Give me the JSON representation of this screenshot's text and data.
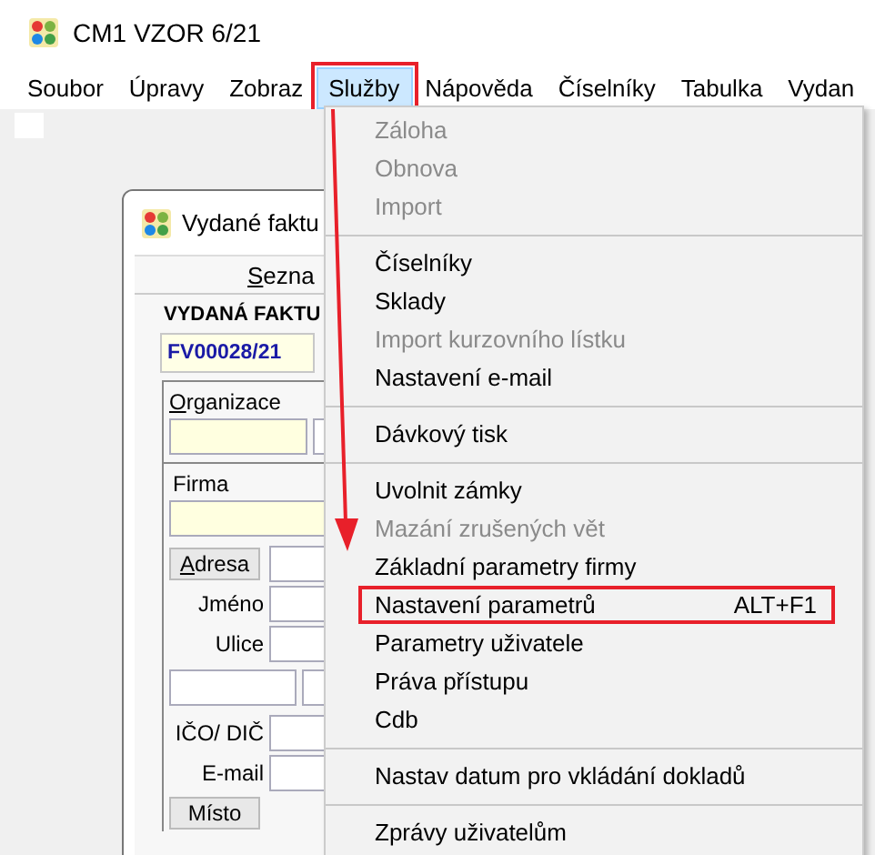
{
  "app": {
    "title": "CM1 VZOR 6/21"
  },
  "menu_bar": [
    {
      "label": "Soubor",
      "selected": false,
      "outlined": false
    },
    {
      "label": "Úpravy",
      "selected": false,
      "outlined": false
    },
    {
      "label": "Zobraz",
      "selected": false,
      "outlined": false
    },
    {
      "label": "Služby",
      "selected": true,
      "outlined": true
    },
    {
      "label": "Nápověda",
      "selected": false,
      "outlined": false
    },
    {
      "label": "Číselníky",
      "selected": false,
      "outlined": false
    },
    {
      "label": "Tabulka",
      "selected": false,
      "outlined": false
    },
    {
      "label": "Vydan",
      "selected": false,
      "outlined": false
    }
  ],
  "dropdown": {
    "groups": [
      [
        {
          "label": "Záloha",
          "disabled": true,
          "outlined": false
        },
        {
          "label": "Obnova",
          "disabled": true,
          "outlined": false
        },
        {
          "label": "Import",
          "disabled": true,
          "outlined": false
        }
      ],
      [
        {
          "label": "Číselníky",
          "disabled": false,
          "outlined": false
        },
        {
          "label": "Sklady",
          "disabled": false,
          "outlined": false
        },
        {
          "label": "Import kurzovního lístku",
          "disabled": true,
          "outlined": false
        },
        {
          "label": "Nastavení e-mail",
          "disabled": false,
          "outlined": false
        }
      ],
      [
        {
          "label": "Dávkový tisk",
          "disabled": false,
          "outlined": false
        }
      ],
      [
        {
          "label": "Uvolnit zámky",
          "disabled": false,
          "outlined": false
        },
        {
          "label": "Mazání zrušených vět",
          "disabled": true,
          "outlined": false
        },
        {
          "label": "Základní parametry firmy",
          "disabled": false,
          "outlined": false
        },
        {
          "label": "Nastavení parametrů",
          "shortcut": "ALT+F1",
          "disabled": false,
          "outlined": true
        },
        {
          "label": "Parametry uživatele",
          "disabled": false,
          "outlined": false
        },
        {
          "label": "Práva přístupu",
          "disabled": false,
          "outlined": false
        },
        {
          "label": "Cdb",
          "disabled": false,
          "outlined": false
        }
      ],
      [
        {
          "label": "Nastav datum pro vkládání dokladů",
          "disabled": false,
          "outlined": false
        }
      ],
      [
        {
          "label": "Zprávy uživatelům",
          "disabled": false,
          "outlined": false
        }
      ]
    ]
  },
  "invoice_window": {
    "title": "Vydané faktu",
    "tab": "Sezna",
    "heading": "VYDANÁ FAKTU",
    "doc_number": "FV00028/21",
    "organization_label": "Organizace",
    "company_label": "Firma",
    "address_button": "Adresa",
    "address_rows": [
      {
        "label": "Jméno"
      },
      {
        "label": "Ulice"
      }
    ],
    "contact_rows": [
      {
        "label": "IČO/ DIČ"
      },
      {
        "label": "E-mail"
      }
    ],
    "place_button": "Místo"
  }
}
